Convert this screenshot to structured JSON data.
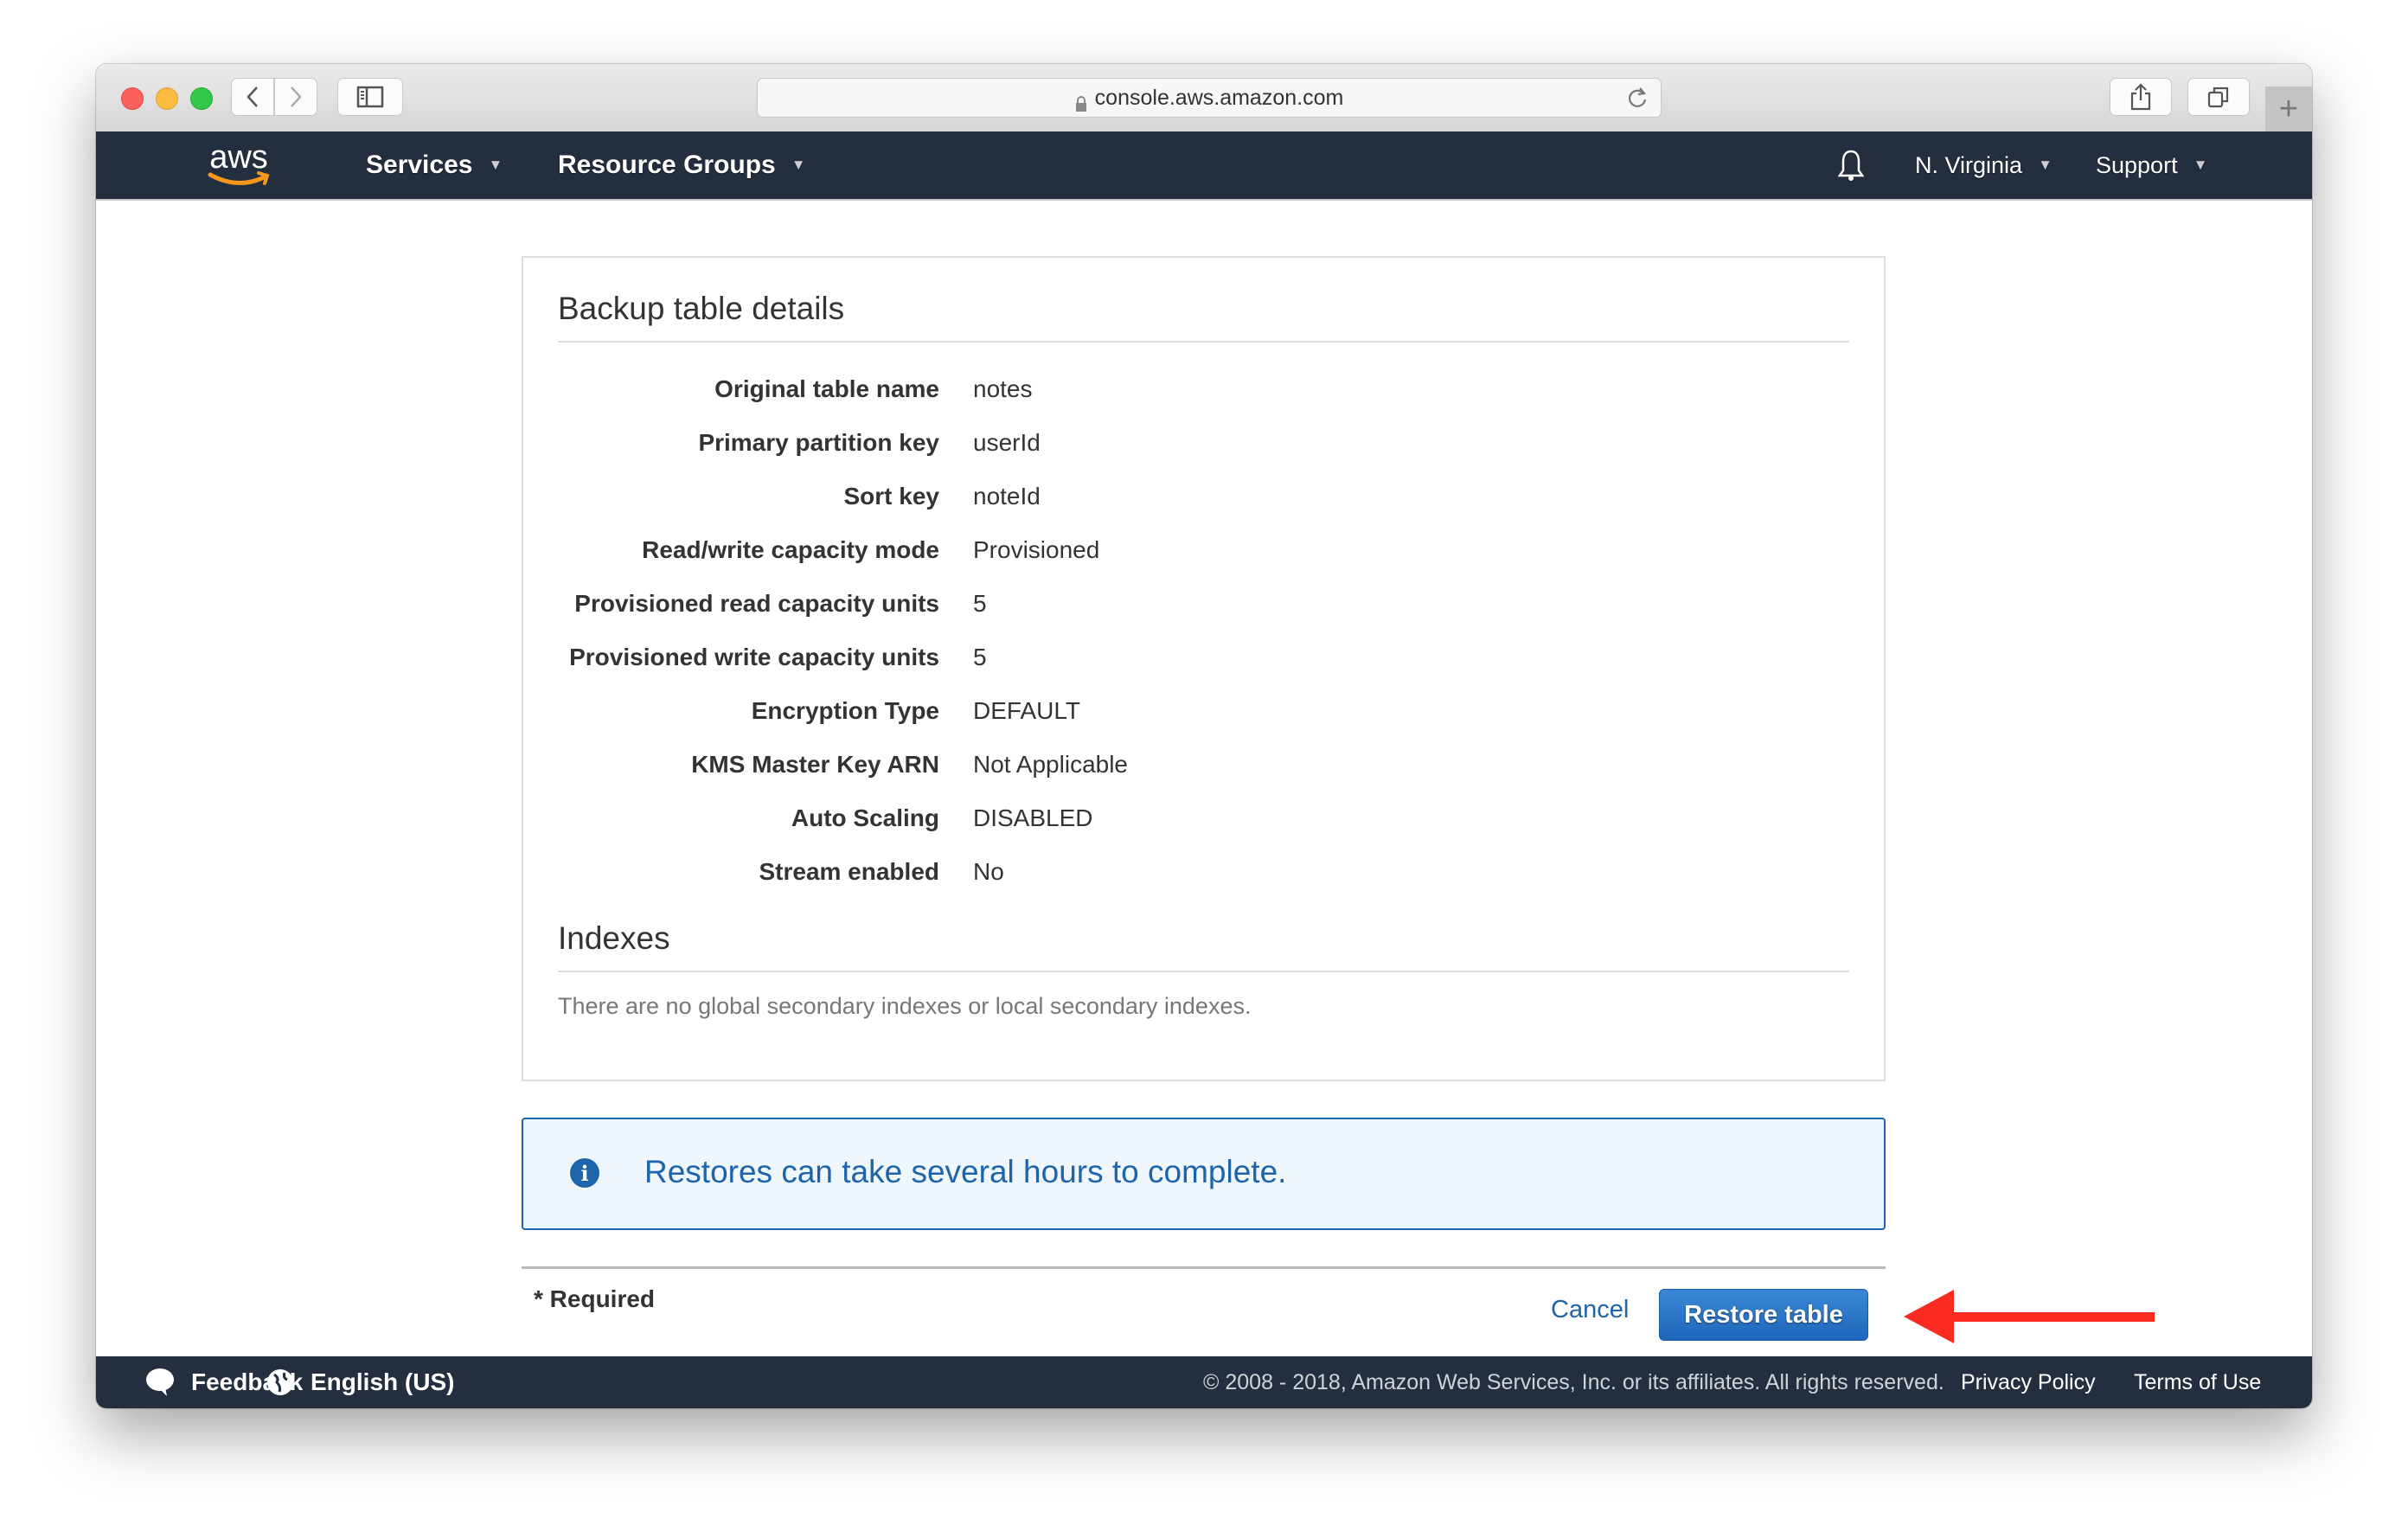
{
  "browser": {
    "url": "console.aws.amazon.com"
  },
  "navbar": {
    "logo": "aws",
    "services": "Services",
    "resource_groups": "Resource Groups",
    "region": "N. Virginia",
    "support": "Support"
  },
  "backup_details": {
    "title": "Backup table details",
    "rows": [
      {
        "label": "Original table name",
        "value": "notes"
      },
      {
        "label": "Primary partition key",
        "value": "userId"
      },
      {
        "label": "Sort key",
        "value": "noteId"
      },
      {
        "label": "Read/write capacity mode",
        "value": "Provisioned"
      },
      {
        "label": "Provisioned read capacity units",
        "value": "5"
      },
      {
        "label": "Provisioned write capacity units",
        "value": "5"
      },
      {
        "label": "Encryption Type",
        "value": "DEFAULT"
      },
      {
        "label": "KMS Master Key ARN",
        "value": "Not Applicable"
      },
      {
        "label": "Auto Scaling",
        "value": "DISABLED"
      },
      {
        "label": "Stream enabled",
        "value": "No"
      }
    ]
  },
  "indexes": {
    "title": "Indexes",
    "empty_message": "There are no global secondary indexes or local secondary indexes."
  },
  "info_alert": {
    "message": "Restores can take several hours to complete."
  },
  "form": {
    "required_note": "* Required",
    "cancel_label": "Cancel",
    "restore_label": "Restore table"
  },
  "footer": {
    "feedback": "Feedback",
    "language": "English (US)",
    "copyright": "© 2008 - 2018, Amazon Web Services, Inc. or its affiliates. All rights reserved.",
    "privacy": "Privacy Policy",
    "terms": "Terms of Use"
  },
  "colors": {
    "nav_bg": "#232f3e",
    "primary_blue": "#1d64ab",
    "info_bg": "#eff7fd",
    "annotation_red": "#f92b20",
    "aws_orange": "#f7981d"
  }
}
